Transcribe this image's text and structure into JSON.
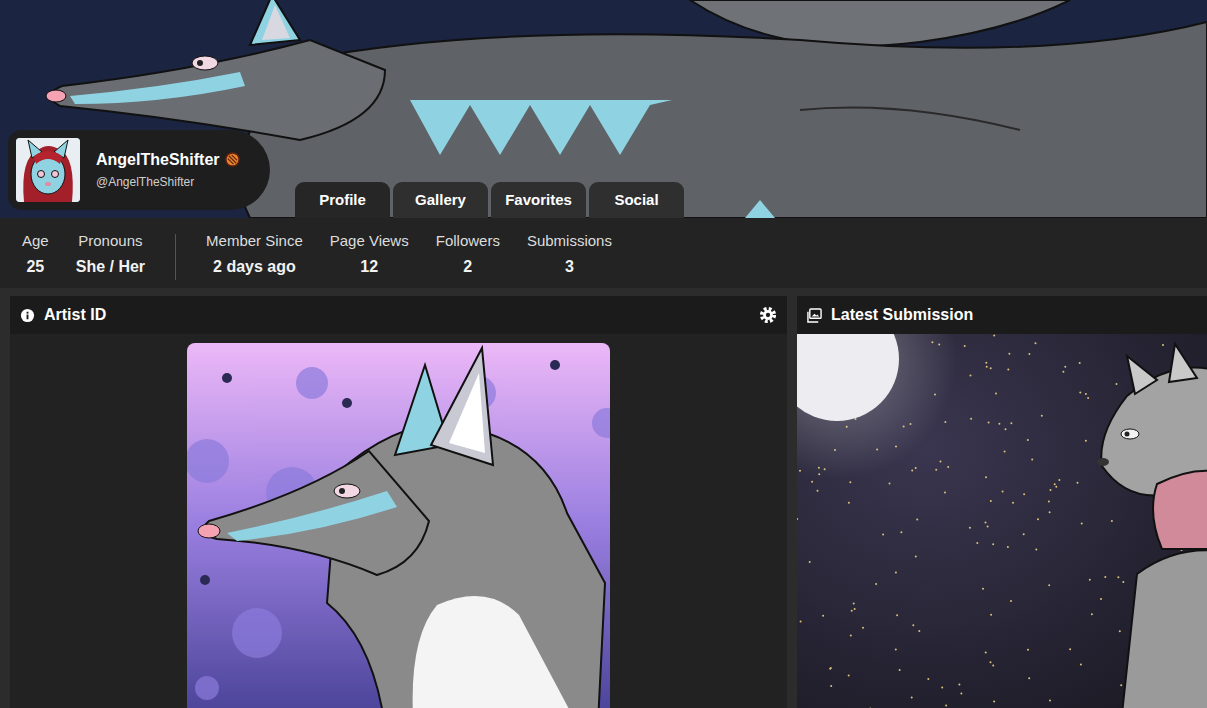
{
  "profile": {
    "name": "AngelTheShifter",
    "handle": "@AngelTheShifter"
  },
  "tabs": [
    {
      "label": "Profile",
      "selected": true
    },
    {
      "label": "Gallery",
      "selected": false
    },
    {
      "label": "Favorites",
      "selected": false
    },
    {
      "label": "Social",
      "selected": false
    }
  ],
  "stat_groups": [
    {
      "items": [
        {
          "label": "Age",
          "value": "25"
        },
        {
          "label": "Pronouns",
          "value": "She / Her"
        }
      ]
    },
    {
      "items": [
        {
          "label": "Member Since",
          "value": "2 days ago"
        },
        {
          "label": "Page Views",
          "value": "12"
        },
        {
          "label": "Followers",
          "value": "2"
        },
        {
          "label": "Submissions",
          "value": "3"
        }
      ]
    }
  ],
  "panels": {
    "artist_id": {
      "title": "Artist ID"
    },
    "latest_submission": {
      "title": "Latest Submission"
    }
  }
}
